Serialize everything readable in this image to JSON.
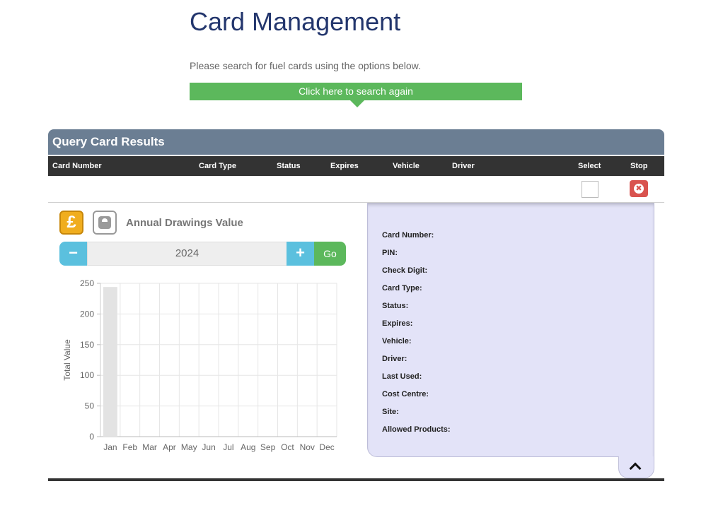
{
  "page": {
    "title": "Card Management",
    "intro": "Please search for fuel cards using the options below.",
    "search_again_label": "Click here to search again"
  },
  "results": {
    "title": "Query Card Results",
    "columns": [
      "Card Number",
      "Card Type",
      "Status",
      "Expires",
      "Vehicle",
      "Driver",
      "Select",
      "Stop"
    ]
  },
  "chart_panel": {
    "pound_icon": "pound-icon",
    "scale_icon": "scale-icon",
    "heading": "Annual Drawings Value",
    "year": "2024",
    "minus_label": "−",
    "plus_label": "+",
    "go_label": "Go"
  },
  "chart_data": {
    "type": "bar",
    "categories": [
      "Jan",
      "Feb",
      "Mar",
      "Apr",
      "May",
      "Jun",
      "Jul",
      "Aug",
      "Sep",
      "Oct",
      "Nov",
      "Dec"
    ],
    "values": [
      244,
      0,
      0,
      0,
      0,
      0,
      0,
      0,
      0,
      0,
      0,
      0
    ],
    "ylabel": "Total Value",
    "ylim": [
      0,
      250
    ],
    "yticks": [
      0,
      50,
      100,
      150,
      200,
      250
    ],
    "grid": true,
    "bar_color": "#e3e3e3"
  },
  "details": {
    "labels": [
      "Card Number:",
      "PIN:",
      "Check Digit:",
      "Card Type:",
      "Status:",
      "Expires:",
      "Vehicle:",
      "Driver:",
      "Last Used:",
      "Cost Centre:",
      "Site:",
      "Allowed Products:"
    ]
  },
  "colors": {
    "title": "#23366d",
    "green": "#5cb85c",
    "info": "#5bc0de",
    "header_bg": "#6b7e93",
    "detail_bg": "#e3e3f8",
    "danger": "#d9534f",
    "pound": "#f0ad1e"
  }
}
